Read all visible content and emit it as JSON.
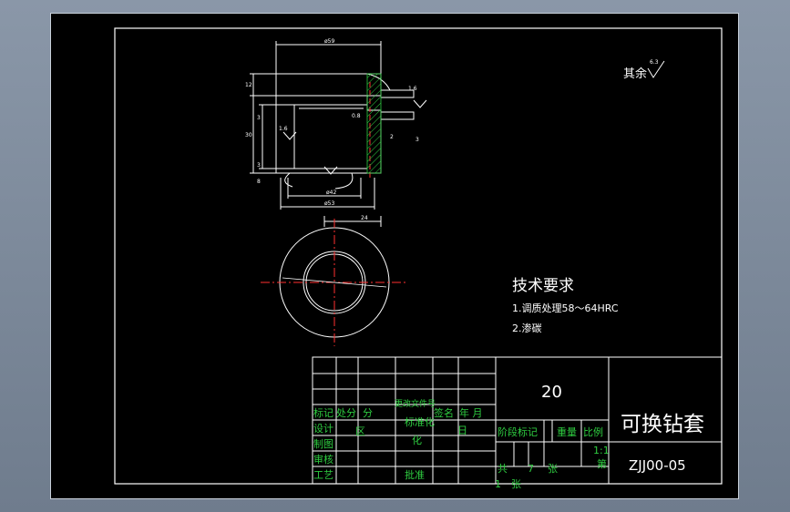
{
  "drawing": {
    "roughness_note": "其余",
    "roughness_value": "6.3",
    "dims": {
      "d_top": "ø59",
      "d_bottom_inner": "ø42",
      "d_bottom_outer": "ø53",
      "h_12": "12",
      "h_3": "3",
      "h_30": "30",
      "h_3b": "3",
      "h_8": "8",
      "v_16": "1.6",
      "v_08": "0.8",
      "v_2": "2",
      "v_3": "3",
      "v_16b": "1.6",
      "w_24": "24"
    },
    "tech_title": "技术要求",
    "tech_items": [
      "1.调质处理58～64HRC",
      "2.渗碳"
    ],
    "title_block": {
      "material": "20",
      "part_name": "可换钻套",
      "drawing_no": "ZJJ00-05",
      "row_labels": [
        "标记",
        "处分",
        "分",
        "更改文件号",
        "签名",
        "年 月"
      ],
      "row2": [
        "设计",
        "区",
        "标准化",
        "日"
      ],
      "row3": [
        "制图",
        "化"
      ],
      "row4": [
        "审核"
      ],
      "row5": [
        "工艺",
        "批准"
      ],
      "stage_headers": [
        "阶段标记",
        "重量",
        "比例"
      ],
      "scale": "1:1",
      "sheet_total_label": "共",
      "sheet_total": "7",
      "sheet_unit": "张",
      "sheet_no_label": "第",
      "sheet_no": "1",
      "sheet_unit2": "张"
    }
  }
}
